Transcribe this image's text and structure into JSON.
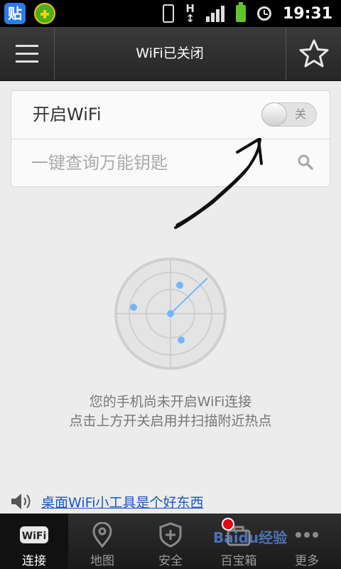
{
  "status_bar": {
    "time": "19:31",
    "apps": [
      "tieba-app-icon",
      "360-plus-app-icon"
    ],
    "network": "H"
  },
  "header": {
    "title": "WiFi已关闭"
  },
  "wifi": {
    "label": "开启WiFi",
    "toggle_state": "关",
    "enabled": false
  },
  "search": {
    "placeholder": "一键查询万能钥匙"
  },
  "empty_state": {
    "line1": "您的手机尚未开启WiFi连接",
    "line2": "点击上方开关启用并扫描附近热点"
  },
  "promo": {
    "text": "桌面WiFi小工具是个好东西"
  },
  "nav": {
    "items": [
      {
        "label": "连接",
        "icon": "wifi-icon",
        "active": true
      },
      {
        "label": "地图",
        "icon": "map-pin-icon",
        "active": false
      },
      {
        "label": "安全",
        "icon": "shield-icon",
        "active": false
      },
      {
        "label": "百宝箱",
        "icon": "toolbox-icon",
        "active": false
      },
      {
        "label": "更多",
        "icon": "more-icon",
        "active": false
      }
    ]
  },
  "watermark": {
    "text": "Baidu经验"
  },
  "colors": {
    "header_bg": "#2e2e2e",
    "link": "#1a55c8",
    "radar_dot": "#6fb8ff",
    "badge": "#e60012"
  }
}
